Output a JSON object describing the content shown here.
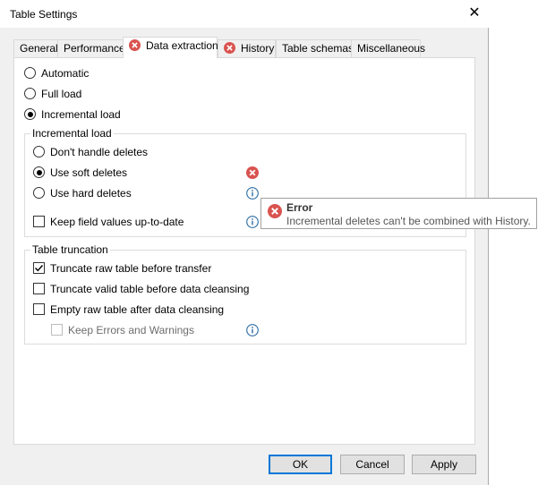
{
  "window": {
    "title": "Table Settings",
    "close_glyph": "✕"
  },
  "tabs": [
    {
      "label": "General",
      "error": false
    },
    {
      "label": "Performance",
      "error": false
    },
    {
      "label": "Data extraction",
      "error": true
    },
    {
      "label": "History",
      "error": true
    },
    {
      "label": "Table schemas",
      "error": false
    },
    {
      "label": "Miscellaneous",
      "error": false
    }
  ],
  "load_mode": {
    "options": [
      {
        "label": "Automatic",
        "selected": false
      },
      {
        "label": "Full load",
        "selected": false
      },
      {
        "label": "Incremental load",
        "selected": true
      }
    ]
  },
  "incremental_load": {
    "legend": "Incremental load",
    "options": [
      {
        "label": "Don't handle deletes",
        "selected": false
      },
      {
        "label": "Use soft deletes",
        "selected": true,
        "status": "error-icon"
      },
      {
        "label": "Use hard deletes",
        "selected": false,
        "status": "info-icon"
      }
    ],
    "keep_field_values": {
      "label": "Keep field values up-to-date",
      "checked": false,
      "status": "info-icon"
    }
  },
  "table_truncation": {
    "legend": "Table truncation",
    "options": [
      {
        "label": "Truncate raw table before transfer",
        "checked": true
      },
      {
        "label": "Truncate valid table before data cleansing",
        "checked": false
      },
      {
        "label": "Empty raw table after data cleansing",
        "checked": false
      },
      {
        "label": "Keep Errors and Warnings",
        "checked": false,
        "disabled": true,
        "status": "info-icon"
      }
    ]
  },
  "tooltip": {
    "title": "Error",
    "message": "Incremental deletes can't be combined with History."
  },
  "buttons": {
    "ok": "OK",
    "cancel": "Cancel",
    "apply": "Apply"
  },
  "colors": {
    "error": "#d9534f",
    "info": "#2b6ca3",
    "accent": "#0078d7"
  }
}
